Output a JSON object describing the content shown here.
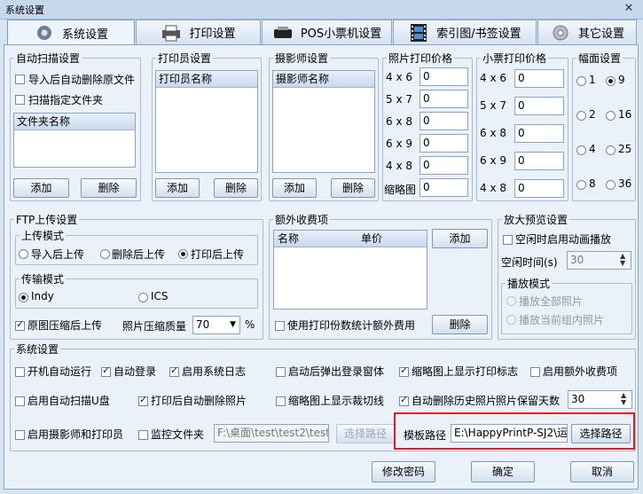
{
  "window": {
    "title": "系统设置",
    "close_glyph": "✕"
  },
  "tabs": [
    {
      "label": "系统设置",
      "icon": "gear-icon"
    },
    {
      "label": "打印设置",
      "icon": "printer-icon"
    },
    {
      "label": "POS小票机设置",
      "icon": "receipt-printer-icon"
    },
    {
      "label": "索引图/书签设置",
      "icon": "film-strip-icon"
    },
    {
      "label": "其它设置",
      "icon": "cog-icon"
    }
  ],
  "auto_scan": {
    "title": "自动扫描设置",
    "opt_delete_after_import": "导入后自动删除原文件",
    "opt_scan_folder": "扫描指定文件夹",
    "list_header": "文件夹名称",
    "add": "添加",
    "delete": "删除"
  },
  "printer_staff": {
    "title": "打印员设置",
    "list_header": "打印员名称",
    "add": "添加",
    "delete": "删除"
  },
  "photographer": {
    "title": "摄影师设置",
    "list_header": "摄影师名称",
    "add": "添加",
    "delete": "删除"
  },
  "photo_price": {
    "title": "照片打印价格",
    "rows": [
      {
        "size": "4 x 6",
        "value": "0"
      },
      {
        "size": "5 x 7",
        "value": "0"
      },
      {
        "size": "6 x 8",
        "value": "0"
      },
      {
        "size": "6 x 9",
        "value": "0"
      },
      {
        "size": "4 x 8",
        "value": "0"
      },
      {
        "size": "缩略图",
        "value": "0"
      }
    ]
  },
  "ticket_price": {
    "title": "小票打印价格",
    "rows": [
      {
        "size": "4 x 6",
        "value": "0"
      },
      {
        "size": "5 x 7",
        "value": "0"
      },
      {
        "size": "6 x 8",
        "value": "0"
      },
      {
        "size": "6 x 9",
        "value": "0"
      },
      {
        "size": "4 x 8",
        "value": "0"
      }
    ]
  },
  "layout": {
    "title": "幅面设置",
    "options": [
      "1",
      "9",
      "2",
      "16",
      "4",
      "25",
      "8",
      "36"
    ],
    "selected": "9"
  },
  "ftp": {
    "title": "FTP上传设置",
    "mode_title": "上传模式",
    "mode_opts": [
      "导入后上传",
      "删除后上传",
      "打印后上传"
    ],
    "mode_selected": "打印后上传",
    "transfer_title": "传输模式",
    "transfer_opts": [
      "Indy",
      "ICS"
    ],
    "transfer_selected": "Indy",
    "compress_label": "原图压缩后上传",
    "quality_label": "照片压缩质量",
    "quality_value": "70",
    "quality_unit": "%"
  },
  "extra_fee": {
    "title": "额外收费项",
    "col_name": "名称",
    "col_price": "单价",
    "add": "添加",
    "use_print_count": "使用打印份数统计额外费用",
    "delete": "删除"
  },
  "preview": {
    "title": "放大预览设置",
    "idle_anim": "空闲时启用动画播放",
    "idle_time_label": "空闲时间(s)",
    "idle_time_value": "30",
    "play_mode_title": "播放模式",
    "play_all": "播放全部照片",
    "play_group": "播放当前组内照片"
  },
  "system": {
    "title": "系统设置",
    "row1": [
      "开机自动运行",
      "自动登录",
      "启用系统日志",
      "启动后弹出登录窗体",
      "缩略图上显示打印标志",
      "启用额外收费项"
    ],
    "row1_checked": [
      false,
      true,
      true,
      false,
      true,
      false
    ],
    "row2": [
      "启用自动扫描U盘",
      "打印后自动删除照片",
      "缩略图上显示裁切线",
      "自动删除历史照片"
    ],
    "row2_checked": [
      false,
      true,
      false,
      true
    ],
    "keep_days_label": "照片保留天数",
    "keep_days_value": "30",
    "row3": [
      "启用摄影师和打印员",
      "监控文件夹"
    ],
    "row3_checked": [
      false,
      false
    ],
    "monitor_path": "F:\\桌面\\test\\test2\\test",
    "choose_path_disabled": "选择路径",
    "template_label": "模板路径",
    "template_path": "E:\\HappyPrintP-SJ2\\运",
    "choose_path": "选择路径"
  },
  "footer": {
    "change_password": "修改密码",
    "ok": "确定",
    "cancel": "取消"
  },
  "colors": {
    "highlight_box": "#e21a23",
    "accent_blue": "#8aa4c8"
  }
}
